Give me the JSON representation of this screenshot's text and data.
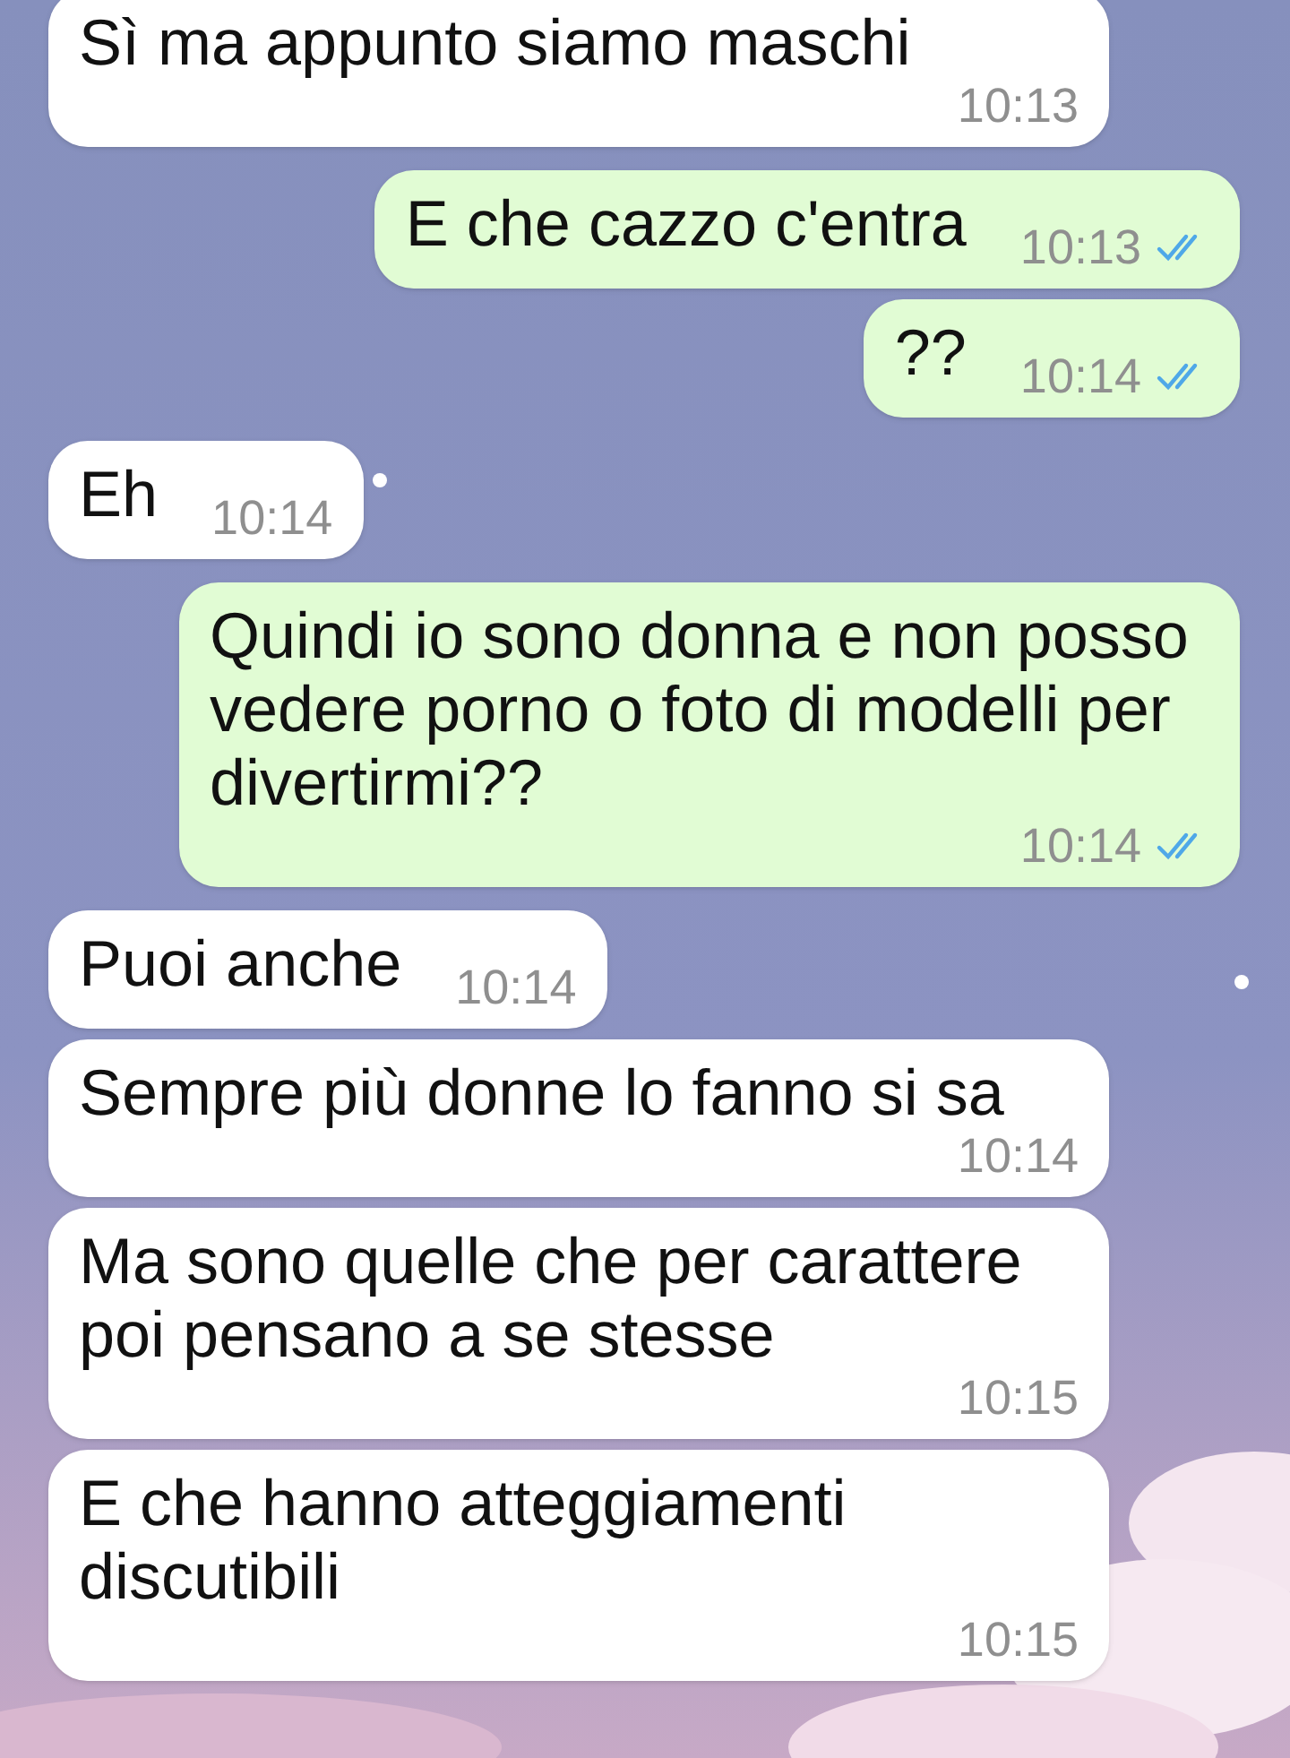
{
  "messages": [
    {
      "kind": "received",
      "text": "Sì ma appunto siamo maschi",
      "time": "10:13"
    },
    {
      "kind": "sent",
      "text": "E che cazzo c'entra",
      "time": "10:13",
      "read": true
    },
    {
      "kind": "sent",
      "text": "??",
      "time": "10:14",
      "read": true
    },
    {
      "kind": "received",
      "text": "Eh",
      "time": "10:14"
    },
    {
      "kind": "sent",
      "text": "Quindi io sono donna e non posso vedere porno o foto di modelli per divertirmi??",
      "time": "10:14",
      "read": true
    },
    {
      "kind": "received",
      "text": "Puoi anche",
      "time": "10:14"
    },
    {
      "kind": "received",
      "text": "Sempre più donne lo fanno si sa",
      "time": "10:14"
    },
    {
      "kind": "received",
      "text": "Ma sono quelle che per carattere poi pensano a se stesse",
      "time": "10:15"
    },
    {
      "kind": "received",
      "text": "E che hanno atteggiamenti discutibili",
      "time": "10:15"
    }
  ]
}
